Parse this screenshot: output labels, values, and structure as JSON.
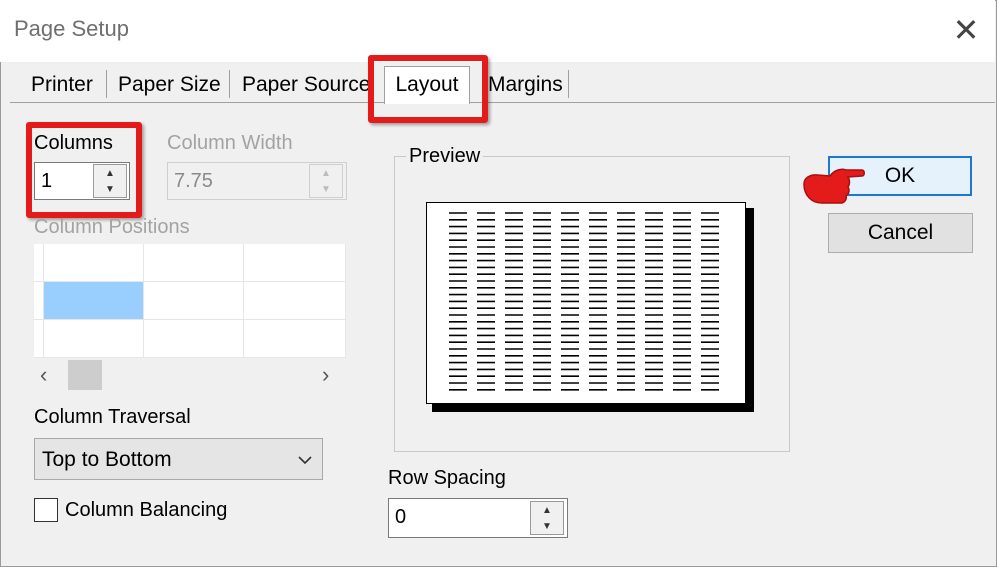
{
  "window": {
    "title": "Page Setup",
    "close_glyph": "✕"
  },
  "tabs": [
    "Printer",
    "Paper Size",
    "Paper Source",
    "Layout",
    "Margins"
  ],
  "active_tab": "Layout",
  "columns": {
    "label": "Columns",
    "value": "1"
  },
  "column_width": {
    "label": "Column Width",
    "value": "7.75"
  },
  "column_positions": {
    "label": "Column Positions"
  },
  "column_traversal": {
    "label": "Column Traversal",
    "value": "Top to Bottom"
  },
  "column_balancing": {
    "label": "Column Balancing",
    "checked": false
  },
  "preview": {
    "label": "Preview"
  },
  "row_spacing": {
    "label": "Row Spacing",
    "value": "0"
  },
  "buttons": {
    "ok": "OK",
    "cancel": "Cancel"
  },
  "icons": {
    "close": "close-icon",
    "spin_up": "spin-up-icon",
    "spin_down": "spin-down-icon",
    "scroll_left": "chevron-left-icon",
    "scroll_right": "chevron-right-icon",
    "dropdown": "chevron-down-icon",
    "pointer": "pointing-hand-icon"
  },
  "colors": {
    "highlight": "#e31b1b",
    "selection": "#99cfff",
    "default_button": "#1d78d4"
  }
}
